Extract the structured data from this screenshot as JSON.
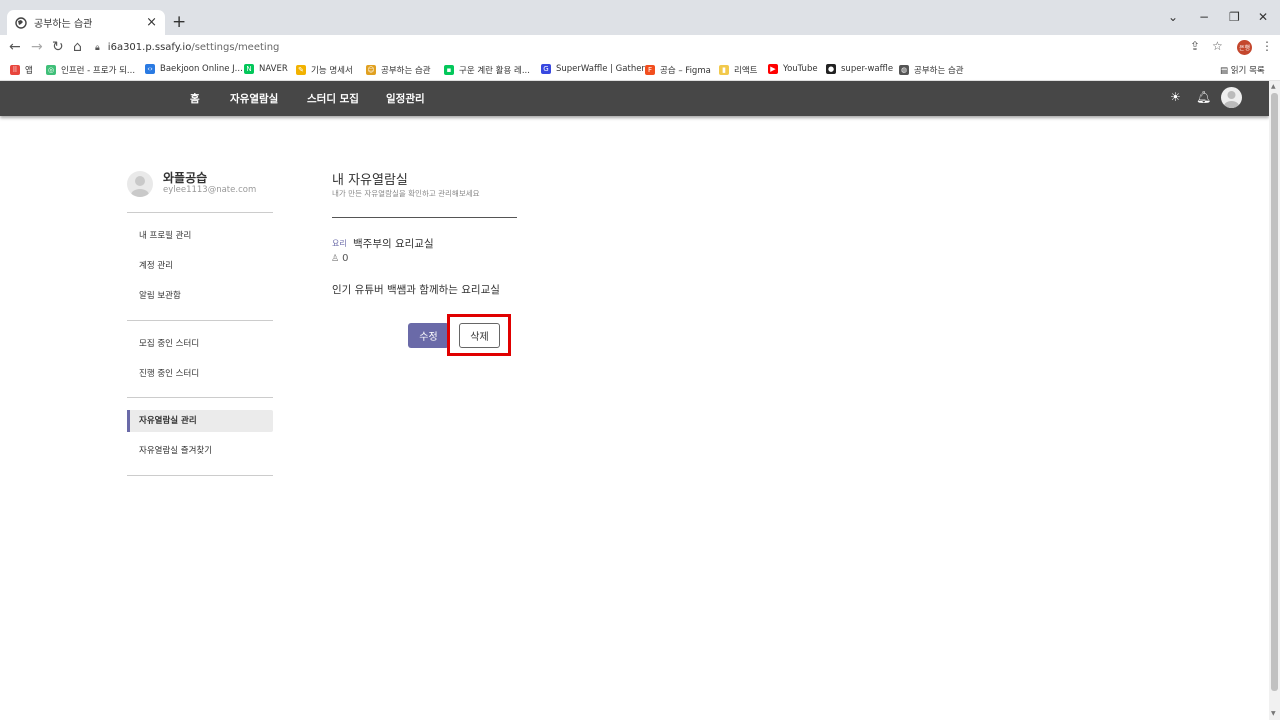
{
  "browser": {
    "tab_title": "공부하는 습관",
    "new_tab": "+",
    "url_host": "i6a301.p.ssafy.io",
    "url_path": "/settings/meeting",
    "profile_badge": "은행",
    "reading_list": "읽기 목록"
  },
  "bookmarks": [
    {
      "label": "앱",
      "color": "#e8453c",
      "glyph": "⠿"
    },
    {
      "label": "인프런 - 프로가 되...",
      "color": "#3fbf78",
      "glyph": "◎"
    },
    {
      "label": "Baekjoon Online J...",
      "color": "#2a7ae2",
      "glyph": "‹›"
    },
    {
      "label": "NAVER",
      "color": "#03c75a",
      "glyph": "N"
    },
    {
      "label": "기능 명세서",
      "color": "#f2b200",
      "glyph": "✎"
    },
    {
      "label": "공부하는 습관",
      "color": "#e0a020",
      "glyph": "☺"
    },
    {
      "label": "구운 계란 활용 레...",
      "color": "#03c75a",
      "glyph": "▪"
    },
    {
      "label": "SuperWaffle | Gather",
      "color": "#3848e0",
      "glyph": "G"
    },
    {
      "label": "공습 – Figma",
      "color": "#f24e1e",
      "glyph": "F"
    },
    {
      "label": "리액트",
      "color": "#f2c94c",
      "glyph": "▮"
    },
    {
      "label": "YouTube",
      "color": "#ff0000",
      "glyph": "▶"
    },
    {
      "label": "super-waffle",
      "color": "#222222",
      "glyph": "●"
    },
    {
      "label": "공부하는 습관",
      "color": "#555555",
      "glyph": "◍"
    }
  ],
  "appnav": {
    "home": "홈",
    "study_room": "자유열람실",
    "recruit": "스터디 모집",
    "schedule": "일정관리"
  },
  "sidebar": {
    "name": "와플공습",
    "email": "eylee1113@nate.com",
    "items": [
      "내 프로필 관리",
      "계정 관리",
      "알림 보관함",
      "모집 중인 스터디",
      "진행 중인 스터디",
      "자유열람실 관리",
      "자유열람실 즐겨찾기"
    ]
  },
  "main": {
    "title": "내 자유열람실",
    "subtitle": "내가 만든 자유열람실을 확인하고 관리해보세요",
    "category": "요리",
    "room_name": "백주부의 요리교실",
    "member_count": "0",
    "description": "인기 유튜버 백쌤과 함께하는 요리교실",
    "edit_label": "수정",
    "delete_label": "삭제"
  },
  "colors": {
    "accent": "#6a6aa8",
    "navbar": "#474747",
    "highlight": "#e00000"
  }
}
